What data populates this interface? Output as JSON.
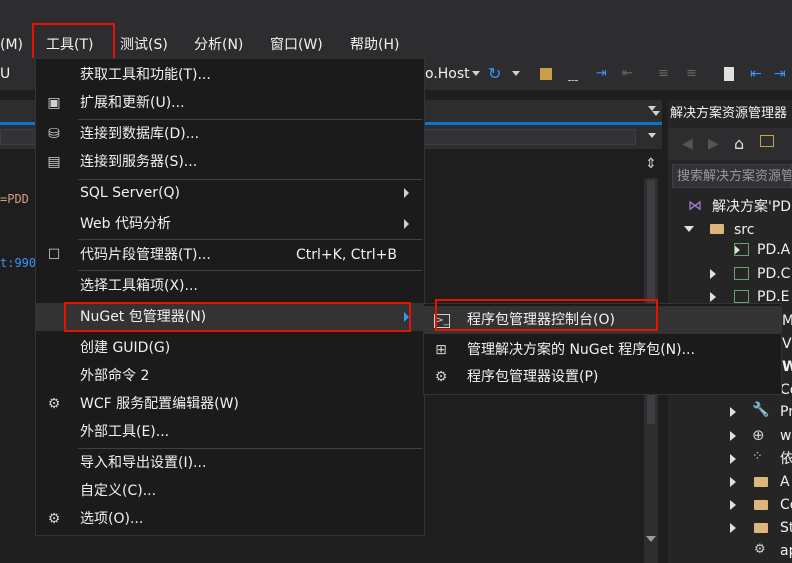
{
  "menubar": {
    "items": [
      {
        "label": "(M)"
      },
      {
        "label": "工具(T)"
      },
      {
        "label": "测试(S)"
      },
      {
        "label": "分析(N)"
      },
      {
        "label": "窗口(W)"
      },
      {
        "label": "帮助(H)"
      }
    ]
  },
  "toolbar": {
    "left_fragment": "U",
    "run_target": "o.Host"
  },
  "editor": {
    "code_line1": "=PDD",
    "code_line2": "t:990"
  },
  "solution_explorer": {
    "title": "解决方案资源管理器",
    "search_placeholder": "搜索解决方案资源管理器",
    "tree": [
      {
        "label": "解决方案'PDD"
      },
      {
        "label": "src"
      },
      {
        "label": "PD.A"
      },
      {
        "label": "PD.C"
      },
      {
        "label": "PD.E"
      },
      {
        "label": "M"
      },
      {
        "label": "V"
      },
      {
        "label": "W"
      },
      {
        "label": "Co"
      },
      {
        "label": "Pr"
      },
      {
        "label": "w"
      },
      {
        "label": "依"
      },
      {
        "label": "A"
      },
      {
        "label": "Co"
      },
      {
        "label": "St"
      },
      {
        "label": "ap"
      }
    ]
  },
  "tools_menu": {
    "items": [
      {
        "label": "获取工具和功能(T)..."
      },
      {
        "label": "扩展和更新(U)..."
      },
      {
        "label": "连接到数据库(D)..."
      },
      {
        "label": "连接到服务器(S)..."
      },
      {
        "label": "SQL Server(Q)"
      },
      {
        "label": "Web 代码分析"
      },
      {
        "label": "代码片段管理器(T)...",
        "shortcut": "Ctrl+K, Ctrl+B"
      },
      {
        "label": "选择工具箱项(X)..."
      },
      {
        "label": "NuGet 包管理器(N)"
      },
      {
        "label": "创建 GUID(G)"
      },
      {
        "label": "外部命令 2"
      },
      {
        "label": "WCF 服务配置编辑器(W)"
      },
      {
        "label": "外部工具(E)..."
      },
      {
        "label": "导入和导出设置(I)..."
      },
      {
        "label": "自定义(C)..."
      },
      {
        "label": "选项(O)..."
      }
    ]
  },
  "nuget_submenu": {
    "items": [
      {
        "label": "程序包管理器控制台(O)",
        "icon": "console-icon"
      },
      {
        "label": "管理解决方案的 NuGet 程序包(N)...",
        "icon": "package-icon"
      },
      {
        "label": "程序包管理器设置(P)",
        "icon": "gear-icon"
      }
    ]
  },
  "colors": {
    "highlight": "#e51400",
    "menu_bg": "#1b1b1c",
    "hover_bg": "#333334",
    "chrome_bg": "#2d2d30"
  }
}
